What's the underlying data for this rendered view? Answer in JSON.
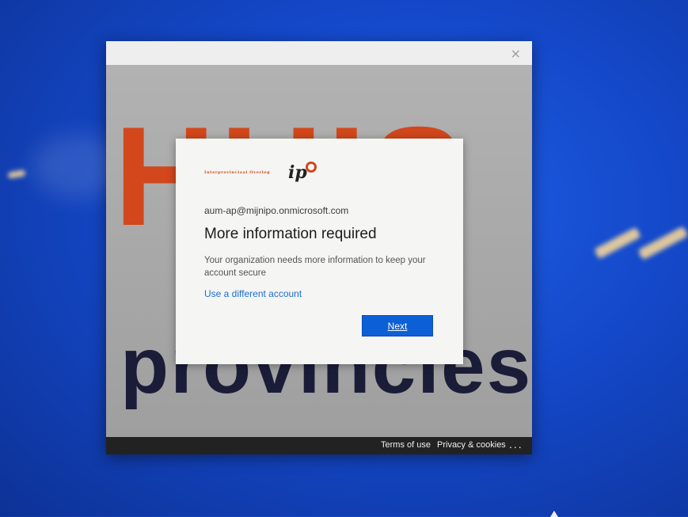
{
  "window": {
    "close_glyph": "×",
    "background_text": {
      "top": "HUIS",
      "bottom": "provincies"
    },
    "footer": {
      "terms": "Terms of use",
      "privacy": "Privacy & cookies",
      "more": "..."
    }
  },
  "dialog": {
    "logo": {
      "text": "Interprovinciaal Overleg",
      "mark": "ip"
    },
    "email": "aum-ap@mijnipo.onmicrosoft.com",
    "heading": "More information required",
    "description": "Your organization needs more information to keep your account secure",
    "link": "Use a different account",
    "next_button": "Next"
  },
  "colors": {
    "brand_orange": "#d2471c",
    "button_blue": "#0d5fd6",
    "link_blue": "#1b6fd0",
    "screen_blue": "#1448c9"
  }
}
